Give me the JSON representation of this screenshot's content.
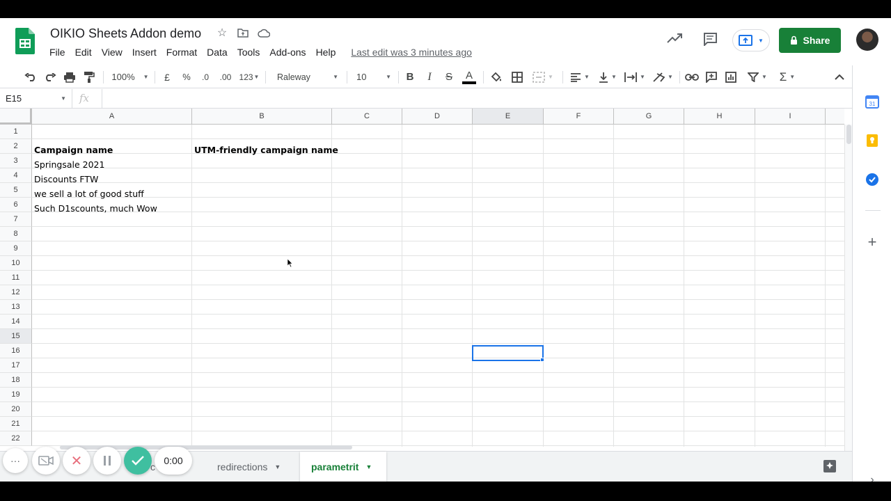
{
  "doc": {
    "title": "OIKIO Sheets Addon demo",
    "last_edit": "Last edit was 3 minutes ago"
  },
  "menu": [
    "File",
    "Edit",
    "View",
    "Insert",
    "Format",
    "Data",
    "Tools",
    "Add-ons",
    "Help"
  ],
  "share": {
    "label": "Share"
  },
  "toolbar": {
    "zoom": "100%",
    "currency": "£",
    "percent": "%",
    "decimal_dec": ".0",
    "decimal_inc": ".00",
    "format": "123",
    "font": "Raleway",
    "font_size": "10",
    "bold": "B",
    "italic": "I",
    "strike": "S",
    "text_color": "A"
  },
  "namebox": {
    "value": "E15"
  },
  "fx": "fx",
  "grid": {
    "columns": [
      "A",
      "B",
      "C",
      "D",
      "E",
      "F",
      "G",
      "H",
      "I"
    ],
    "rows": [
      "1",
      "2",
      "3",
      "4",
      "5",
      "6",
      "7",
      "8",
      "9",
      "10",
      "11",
      "12",
      "13",
      "14",
      "15",
      "16",
      "17",
      "18",
      "19",
      "20",
      "21",
      "22"
    ],
    "selected_cell": "E15",
    "cells": {
      "a1": "Campaign name",
      "b1": "UTM-friendly campaign name",
      "a2": "Springsale 2021",
      "a3": "Discounts FTW",
      "a4": "we sell a lot of good stuff",
      "a5": "Such D1scounts, much Wow"
    }
  },
  "tabs": [
    {
      "label": "redirections"
    },
    {
      "label": "parametrit"
    }
  ],
  "tab_partial": "c",
  "recorder": {
    "timer": "0:00"
  },
  "colors": {
    "brand_green": "#188038",
    "selection_blue": "#1a73e8"
  }
}
